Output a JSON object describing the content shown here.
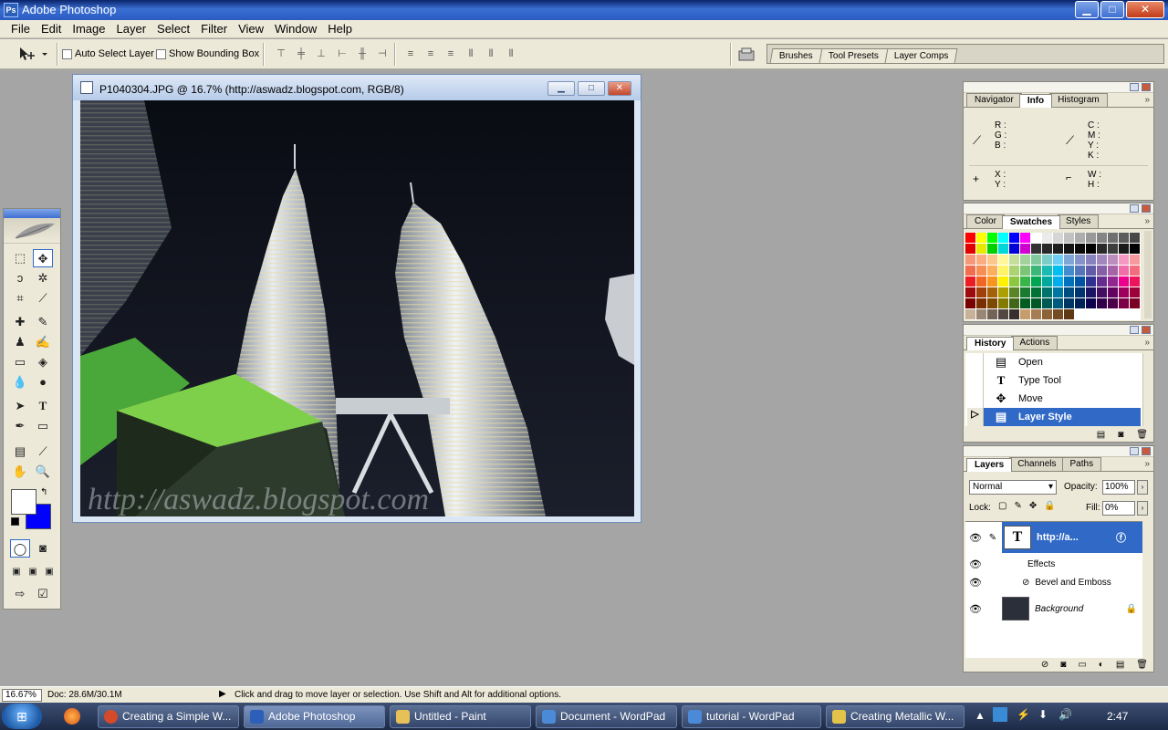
{
  "app": {
    "title": "Adobe Photoshop"
  },
  "window_controls": {
    "minimize": "▁",
    "maximize": "□",
    "close": "✕"
  },
  "menu": [
    "File",
    "Edit",
    "Image",
    "Layer",
    "Select",
    "Filter",
    "View",
    "Window",
    "Help"
  ],
  "options": {
    "auto_select_label": "Auto Select Layer",
    "bounding_box_label": "Show Bounding Box",
    "well_tabs": [
      "Brushes",
      "Tool Presets",
      "Layer Comps"
    ]
  },
  "document": {
    "title": "P1040304.JPG @ 16.7% (http://aswadz.blogspot.com, RGB/8)",
    "watermark": "http://aswadz.blogspot.com"
  },
  "navigator_panel": {
    "tabs": [
      "Navigator",
      "Info",
      "Histogram"
    ],
    "active_tab": "Info",
    "rgb_labels": [
      "R :",
      "G :",
      "B :"
    ],
    "cmyk_labels": [
      "C :",
      "M :",
      "Y :",
      "K :"
    ],
    "xy_labels": [
      "X :",
      "Y :"
    ],
    "wh_labels": [
      "W :",
      "H :"
    ]
  },
  "color_panel": {
    "tabs": [
      "Color",
      "Swatches",
      "Styles"
    ],
    "active_tab": "Swatches",
    "swatches": [
      "#ff0000",
      "#ffff00",
      "#00ff00",
      "#00ffff",
      "#0000ff",
      "#ff00ff",
      "#ffffff",
      "#ebebeb",
      "#d6d6d6",
      "#c2c2c2",
      "#adadad",
      "#999999",
      "#858585",
      "#707070",
      "#5c5c5c",
      "#474747",
      "#e00000",
      "#e8e800",
      "#00d000",
      "#00d8d8",
      "#0000d8",
      "#d000d0",
      "#333333",
      "#292929",
      "#1f1f1f",
      "#141414",
      "#0a0a0a",
      "#000000",
      "#2a2a2a",
      "#3d3d3d",
      "#1a1a1a",
      "#000000",
      "#f7977a",
      "#f9ad81",
      "#fdc68a",
      "#fff79a",
      "#c4df9b",
      "#a2d39c",
      "#82ca9d",
      "#7bcdc8",
      "#6ecff6",
      "#7ea7d8",
      "#8493ca",
      "#8882be",
      "#a187be",
      "#bc8dbf",
      "#f49ac2",
      "#f6989d",
      "#f26c4f",
      "#f68e55",
      "#fbaf5c",
      "#fff467",
      "#acd372",
      "#7cc576",
      "#3bb878",
      "#1abbb4",
      "#00bff3",
      "#438ccb",
      "#5574b9",
      "#605ca8",
      "#855fa8",
      "#a763a8",
      "#f06ea9",
      "#f26d7d",
      "#ed1c24",
      "#f26522",
      "#f7941d",
      "#fff200",
      "#8dc73f",
      "#39b54a",
      "#00a651",
      "#00a99d",
      "#00aeef",
      "#0072bc",
      "#0054a6",
      "#2e3192",
      "#662d91",
      "#92278f",
      "#ec008c",
      "#ed145b",
      "#9e0b0f",
      "#a0410d",
      "#a36209",
      "#aba000",
      "#598527",
      "#1a7b30",
      "#007236",
      "#00746b",
      "#0076a3",
      "#004b80",
      "#003471",
      "#1b1464",
      "#440e62",
      "#630460",
      "#9e005d",
      "#9e0039",
      "#790000",
      "#7b2e00",
      "#7d4900",
      "#827b00",
      "#406618",
      "#005e20",
      "#005826",
      "#005952",
      "#005b7f",
      "#003663",
      "#002157",
      "#0d004c",
      "#32004b",
      "#4b0049",
      "#7b0046",
      "#7a0026",
      "#c7b299",
      "#998675",
      "#736357",
      "#534741",
      "#37302d",
      "#c69c6d",
      "#a67c52",
      "#8c6239",
      "#754c24",
      "#603913",
      "#ffffff",
      "#ffffff",
      "#ffffff",
      "#ffffff",
      "#ffffff",
      "#ffffff"
    ]
  },
  "history_panel": {
    "tabs": [
      "History",
      "Actions"
    ],
    "active_tab": "History",
    "items": [
      {
        "icon": "document-icon",
        "label": "Open",
        "selected": false
      },
      {
        "icon": "type-icon",
        "label": "Type Tool",
        "selected": false
      },
      {
        "icon": "move-icon",
        "label": "Move",
        "selected": false
      },
      {
        "icon": "document-icon",
        "label": "Layer Style",
        "selected": true
      }
    ]
  },
  "layers_panel": {
    "tabs": [
      "Layers",
      "Channels",
      "Paths"
    ],
    "active_tab": "Layers",
    "blend_mode": "Normal",
    "opacity_label": "Opacity:",
    "opacity": "100%",
    "lock_label": "Lock:",
    "fill_label": "Fill:",
    "fill": "0%",
    "layers": {
      "text_layer": "http://a...",
      "effects": "Effects",
      "effect_item": "Bevel and Emboss",
      "background": "Background"
    }
  },
  "status": {
    "zoom": "16.67%",
    "doc": "Doc: 28.6M/30.1M",
    "hint": "Click and drag to move layer or selection.  Use Shift and Alt for additional options."
  },
  "taskbar": {
    "items": [
      {
        "label": "Creating a Simple W...",
        "icon_color": "#d64a2a"
      },
      {
        "label": "Adobe Photoshop",
        "icon_color": "#2b5fb8"
      },
      {
        "label": "Untitled - Paint",
        "icon_color": "#e7c05a"
      },
      {
        "label": "Document - WordPad",
        "icon_color": "#4a8ad6"
      },
      {
        "label": "tutorial - WordPad",
        "icon_color": "#4a8ad6"
      },
      {
        "label": "Creating Metallic W...",
        "icon_color": "#e4c34a"
      }
    ],
    "clock": "2:47"
  }
}
